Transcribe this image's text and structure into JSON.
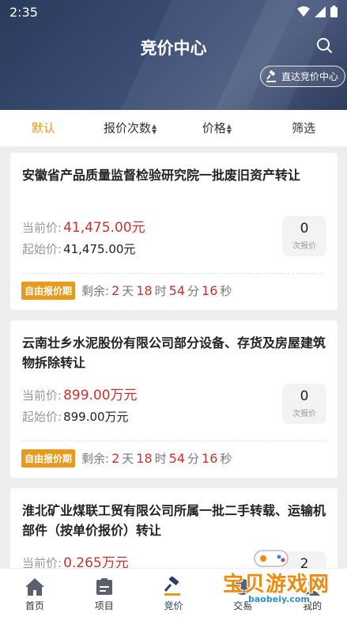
{
  "status": {
    "time": "2:35"
  },
  "header": {
    "title": "竞价中心",
    "direct_btn": "直达竞价中心"
  },
  "sort": [
    {
      "label": "默认",
      "active": true
    },
    {
      "label": "报价次数",
      "arrows": true
    },
    {
      "label": "价格",
      "arrows": true
    },
    {
      "label": "筛选"
    }
  ],
  "cards": [
    {
      "title": "安徽省产品质量监督检验研究院一批废旧资产转让",
      "current_label": "当前价:",
      "current_value": "41,475.00元",
      "start_label": "起始价:",
      "start_value": "41,475.00元",
      "bid_count": "0",
      "bid_label": "次报价",
      "badge": "自由报价期",
      "remain_label": "剩余:",
      "days": "2",
      "day_unit": "天",
      "hours": "18",
      "hour_unit": "时",
      "minutes": "54",
      "minute_unit": "分",
      "seconds": "16",
      "second_unit": "秒"
    },
    {
      "title": "云南壮乡水泥股份有限公司部分设备、存货及房屋建筑物拆除转让",
      "current_label": "当前价:",
      "current_value": "899.00万元",
      "start_label": "起始价:",
      "start_value": "899.00万元",
      "bid_count": "0",
      "bid_label": "次报价",
      "badge": "自由报价期",
      "remain_label": "剩余:",
      "days": "2",
      "day_unit": "天",
      "hours": "18",
      "hour_unit": "时",
      "minutes": "54",
      "minute_unit": "分",
      "seconds": "16",
      "second_unit": "秒"
    },
    {
      "title": "淮北矿业煤联工贸有限公司所属一批二手转载、运输机部件（按单价报价）转让",
      "current_label": "当前价:",
      "current_value": "0.265万元",
      "bid_count": "2"
    }
  ],
  "nav": [
    {
      "label": "首页",
      "icon": "home-icon"
    },
    {
      "label": "项目",
      "icon": "project-icon"
    },
    {
      "label": "竞价",
      "icon": "auction-icon",
      "active": true
    },
    {
      "label": "交易",
      "icon": "trade-icon"
    },
    {
      "label": "我的",
      "icon": "profile-icon"
    }
  ],
  "watermark": {
    "text": "宝贝游戏网",
    "url": "baobeiy.com"
  },
  "colors": {
    "header": "#3b4c73",
    "accent": "#e69a1e",
    "price": "#c8332e"
  }
}
